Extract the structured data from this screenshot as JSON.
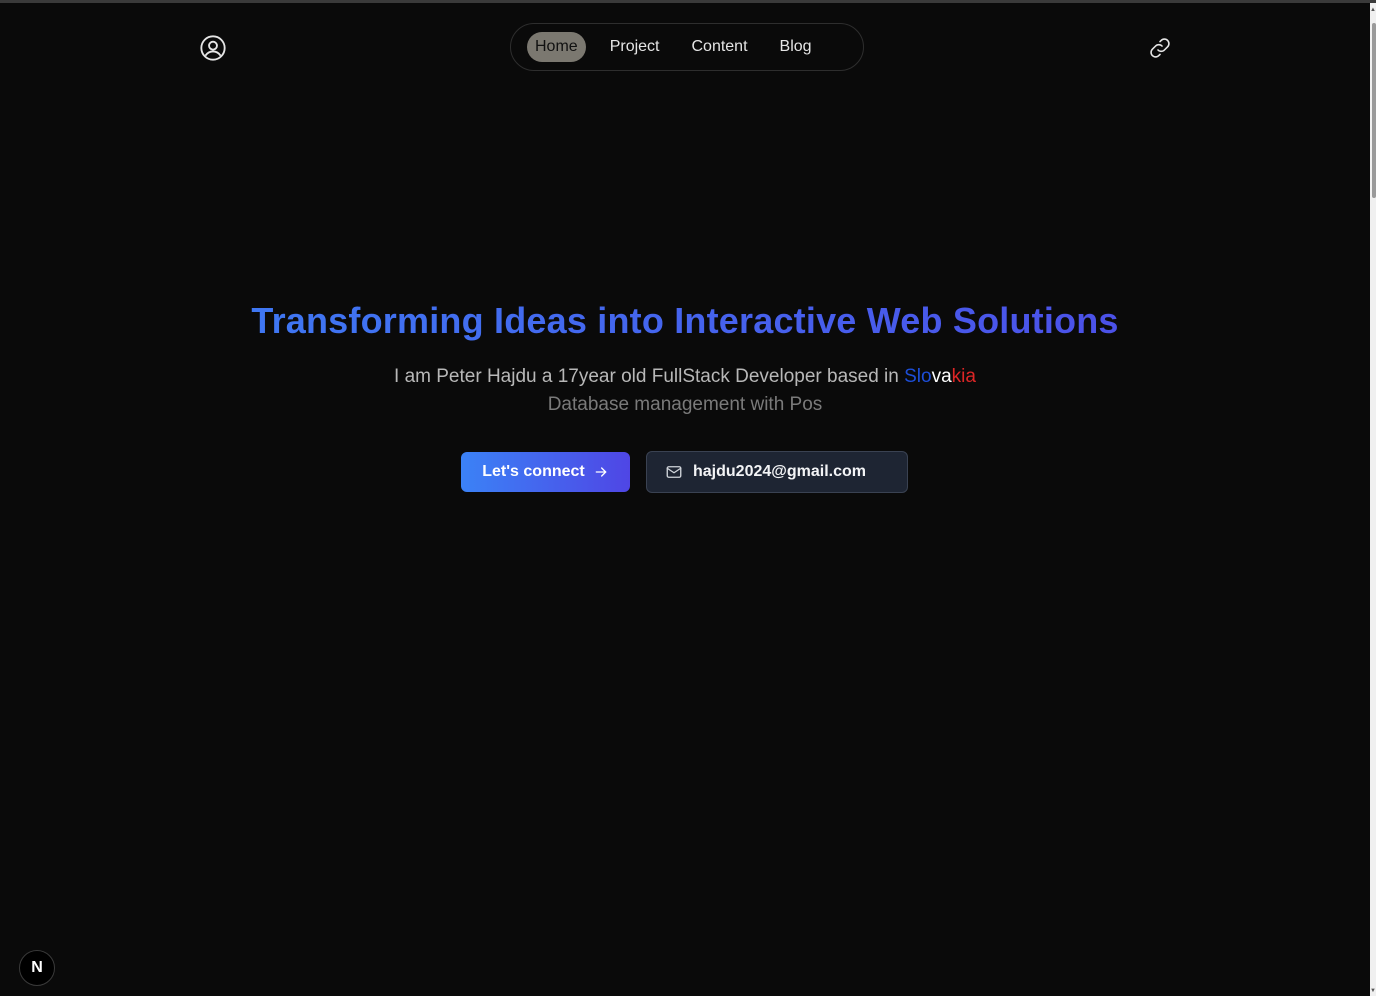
{
  "nav": {
    "items": [
      {
        "label": "Home",
        "active": true
      },
      {
        "label": "Project",
        "active": false
      },
      {
        "label": "Content",
        "active": false
      },
      {
        "label": "Blog",
        "active": false
      }
    ],
    "left_icon": "user-circle-icon",
    "right_icon": "link-icon"
  },
  "hero": {
    "title": "Transforming Ideas into Interactive Web Solutions",
    "subtitle_prefix": "I am Peter Hajdu a 17year old FullStack Developer based in ",
    "country_part1": "Slo",
    "country_part2": "va",
    "country_part3": "kia",
    "tagline": "Database management with Pos"
  },
  "actions": {
    "connect_label": "Let's connect",
    "email": "hajdu2024@gmail.com"
  },
  "badge": {
    "letter": "N"
  },
  "colors": {
    "background": "#0a0a0a",
    "gradient_start": "#3b82f6",
    "gradient_end": "#4f46e5",
    "flag_blue": "#1d4ed8",
    "flag_white": "#ffffff",
    "flag_red": "#dc2626"
  }
}
